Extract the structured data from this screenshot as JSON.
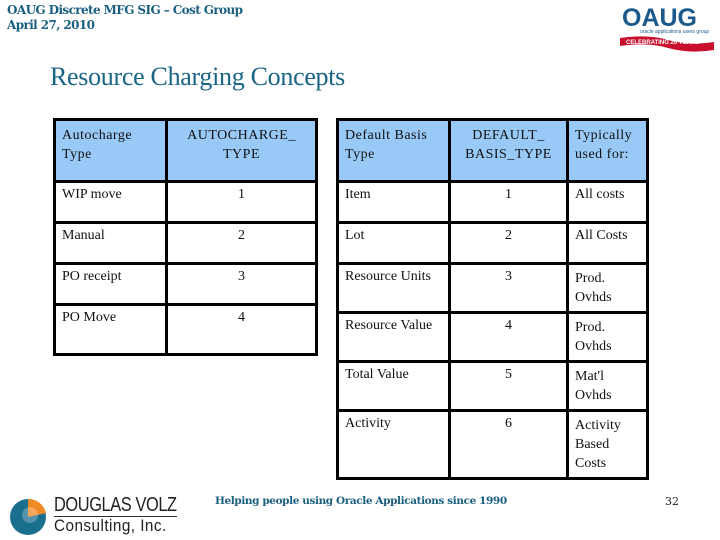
{
  "header": {
    "line1": "OAUG Discrete MFG SIG – Cost Group",
    "line2": "April 27, 2010"
  },
  "logo_oaug": {
    "main": "OAUG",
    "sub": "oracle applications users group",
    "banner": "CELEBRATING 20 YEARS"
  },
  "title": "Resource Charging Concepts",
  "autocharge_table": {
    "headers": [
      "Autocharge Type",
      "AUTOCHARGE_ TYPE"
    ],
    "rows": [
      [
        "WIP move",
        "1"
      ],
      [
        "Manual",
        "2"
      ],
      [
        "PO receipt",
        "3"
      ],
      [
        "PO Move",
        "4"
      ]
    ]
  },
  "basis_table": {
    "headers": [
      "Default Basis Type",
      "DEFAULT_ BASIS_TYPE",
      "Typically used for:"
    ],
    "rows": [
      [
        "Item",
        "1",
        "All costs"
      ],
      [
        "Lot",
        "2",
        "All Costs"
      ],
      [
        "Resource Units",
        "3",
        "Prod. Ovhds"
      ],
      [
        "Resource Value",
        "4",
        "Prod. Ovhds"
      ],
      [
        "Total Value",
        "5",
        "Mat'l Ovhds"
      ],
      [
        "Activity",
        "6",
        "Activity Based Costs"
      ]
    ]
  },
  "footer": {
    "company_name": "DOUGLAS VOLZ",
    "company_sub": "Consulting, Inc.",
    "tagline": "Helping people using Oracle Applications since 1990",
    "page_number": "32"
  },
  "colors": {
    "header_text": "#1b5f80",
    "table_header_bg": "#99c9f7",
    "oaug_blue": "#1d5a8c",
    "oaug_red": "#c8102e"
  }
}
